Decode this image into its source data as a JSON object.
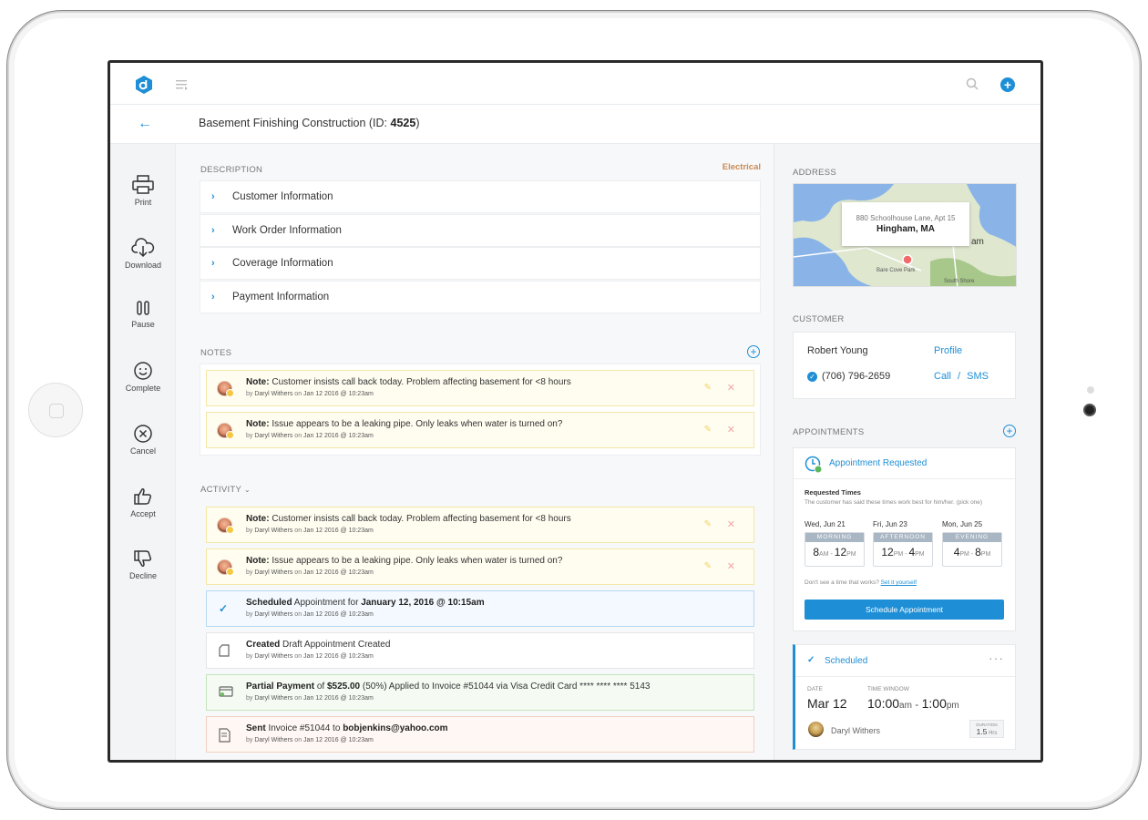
{
  "header": {
    "title_prefix": "Basement Finishing Construction (ID: ",
    "title_id": "4525",
    "title_suffix": ")"
  },
  "sidebar": {
    "items": [
      {
        "label": "Print"
      },
      {
        "label": "Download"
      },
      {
        "label": "Pause"
      },
      {
        "label": "Complete"
      },
      {
        "label": "Cancel"
      },
      {
        "label": "Accept"
      },
      {
        "label": "Decline"
      }
    ]
  },
  "description": {
    "label": "DESCRIPTION",
    "tag": "Electrical",
    "sections": [
      {
        "label": "Customer Information"
      },
      {
        "label": "Work Order Information"
      },
      {
        "label": "Coverage Information"
      },
      {
        "label": "Payment Information"
      }
    ]
  },
  "notes": {
    "label": "NOTES",
    "items": [
      {
        "kind": "Note:",
        "text": " Customer insists call back today. Problem affecting basement for <8 hours",
        "by": "by ",
        "author": "Daryl Withers",
        "on": " on ",
        "date": "Jan 12 2016 @ 10:23am"
      },
      {
        "kind": "Note:",
        "text": " Issue appears to be a leaking pipe. Only leaks when water is turned on?",
        "by": "by ",
        "author": "Daryl Withers",
        "on": " on ",
        "date": "Jan 12 2016 @ 10:23am"
      }
    ]
  },
  "activity": {
    "label": "ACTIVITY",
    "items": [
      {
        "bold1": "Note:",
        "text1": " Customer insists call back today. Problem affecting basement for <8 hours",
        "bold2": "",
        "text2": "",
        "bold3": "",
        "text3": "",
        "author": "Daryl Withers",
        "date": "Jan 12 2016 @ 10:23am"
      },
      {
        "bold1": "Note:",
        "text1": " Issue appears to be a leaking pipe. Only leaks when water is turned on?",
        "bold2": "",
        "text2": "",
        "bold3": "",
        "text3": "",
        "author": "Daryl Withers",
        "date": "Jan 12 2016 @ 10:23am"
      },
      {
        "bold1": "Scheduled",
        "text1": " Appointment for ",
        "bold2": "January 12, 2016 @ 10:15am",
        "text2": "",
        "bold3": "",
        "text3": "",
        "author": "Daryl Withers",
        "date": "Jan 12 2016 @ 10:23am"
      },
      {
        "bold1": "Created",
        "text1": " Draft Appointment Created",
        "bold2": "",
        "text2": "",
        "bold3": "",
        "text3": "",
        "author": "Daryl Withers",
        "date": "Jan 12 2016 @ 10:23am"
      },
      {
        "bold1": "Partial Payment",
        "text1": " of ",
        "bold2": "$525.00",
        "text2": " (50%) Applied to Invoice #51044 via Visa Credit Card **** **** **** 5143",
        "bold3": "",
        "text3": "",
        "author": "Daryl Withers",
        "date": "Jan 12 2016 @ 10:23am"
      },
      {
        "bold1": "Sent",
        "text1": " Invoice #51044 to ",
        "bold2": "bobjenkins@yahoo.com",
        "text2": "",
        "bold3": "",
        "text3": "",
        "author": "Daryl Withers",
        "date": "Jan 12 2016 @ 10:23am"
      }
    ],
    "by": "by ",
    "on": " on "
  },
  "address": {
    "label": "ADDRESS",
    "line1": "880 Schoolhouse Lane, Apt 15",
    "line2": "Hingham, MA",
    "map_labels": {
      "park": "Bare Cove Park",
      "south": "South Shore",
      "am": "am"
    }
  },
  "customer": {
    "label": "CUSTOMER",
    "name": "Robert Young",
    "profile": "Profile",
    "phone": "(706) 796-2659",
    "call": "Call",
    "sep": "/",
    "sms": "SMS"
  },
  "appointments": {
    "label": "APPOINTMENTS",
    "requested": {
      "title": "Appointment Requested",
      "times_title": "Requested Times",
      "times_sub": "The customer has said these times work best for him/her. (pick one)",
      "slots": [
        {
          "date": "Wed, Jun 21",
          "period": "MORNING",
          "start": "8",
          "start_suf": "AM",
          "dash": " - ",
          "end": "12",
          "end_suf": "PM"
        },
        {
          "date": "Fri, Jun 23",
          "period": "AFTERNOON",
          "start": "12",
          "start_suf": "PM",
          "dash": " - ",
          "end": "4",
          "end_suf": "PM"
        },
        {
          "date": "Mon, Jun 25",
          "period": "EVENING",
          "start": "4",
          "start_suf": "PM",
          "dash": " - ",
          "end": "8",
          "end_suf": "PM"
        }
      ],
      "no_time": "Don't see a time that works? ",
      "set_yourself": "Set it yourself",
      "button": "Schedule Appointment"
    },
    "scheduled": {
      "title": "Scheduled",
      "date_label": "DATE",
      "date": "Mar 12",
      "window_label": "TIME WINDOW",
      "start": "10:00",
      "start_suf": "am",
      "dash": " - ",
      "end": "1:00",
      "end_suf": "pm",
      "tech": "Daryl Withers",
      "duration_label": "DURATION",
      "duration": "1.5",
      "duration_unit": " Hrs"
    }
  },
  "colors": {
    "accent": "#1e8fd6",
    "tag": "#c98a55"
  }
}
